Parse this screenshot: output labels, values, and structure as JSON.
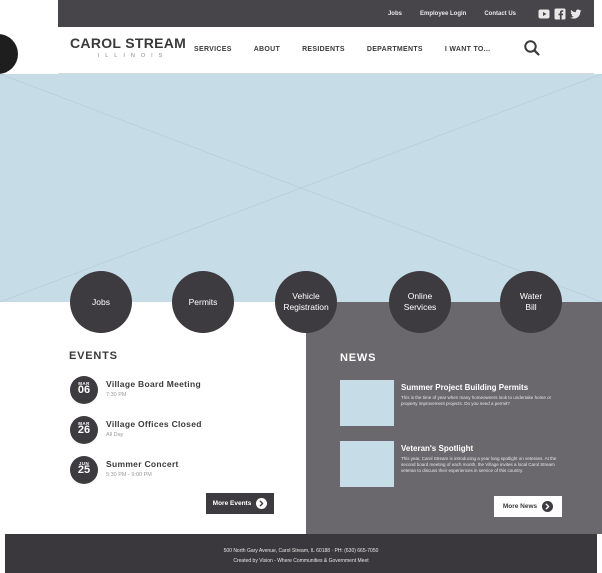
{
  "utility": {
    "links": [
      "Jobs",
      "Employee Login",
      "Contact Us"
    ],
    "social_icons": [
      "youtube-icon",
      "facebook-icon",
      "twitter-icon"
    ]
  },
  "header": {
    "logo_name": "CAROL STREAM",
    "logo_sub": "ILLINOIS",
    "nav": [
      "SERVICES",
      "ABOUT",
      "RESIDENTS",
      "DEPARTMENTS",
      "I WANT TO..."
    ],
    "search_icon": "search-icon"
  },
  "quick_links": [
    "Jobs",
    "Permits",
    "Vehicle Registration",
    "Online Services",
    "Water Bill"
  ],
  "events": {
    "title": "EVENTS",
    "items": [
      {
        "month": "MAR",
        "day": "06",
        "title": "Village Board Meeting",
        "time": "7:30 PM"
      },
      {
        "month": "MAR",
        "day": "26",
        "title": "Village Offices Closed",
        "time": "All Day"
      },
      {
        "month": "JUN",
        "day": "25",
        "title": "Summer Concert",
        "time": "5:30 PM - 9:00 PM"
      }
    ],
    "more_label": "More Events"
  },
  "news": {
    "title": "NEWS",
    "items": [
      {
        "headline": "Summer Project Building Permits",
        "body": "This is the time of year when many homeowners look to undertake home or property improvement projects. Do you need a permit?"
      },
      {
        "headline": "Veteran's Spotlight",
        "body": "This year, Carol Stream is introducing a year long spotlight on veterans. At the second board meeting of each month, the Village invites a local Carol Stream veteran to discuss their experiences in service of this country."
      }
    ],
    "more_label": "More News"
  },
  "footer": {
    "address": "500 North Gary Avenue, Carol Stream, IL 60188  ·  PH: (630) 665-7050",
    "credit": "Created by Vision - Where Communities & Government Meet"
  },
  "colors": {
    "dark": "#3d3b3f",
    "news_bg": "#6a686c",
    "hero": "#c6dde8"
  }
}
